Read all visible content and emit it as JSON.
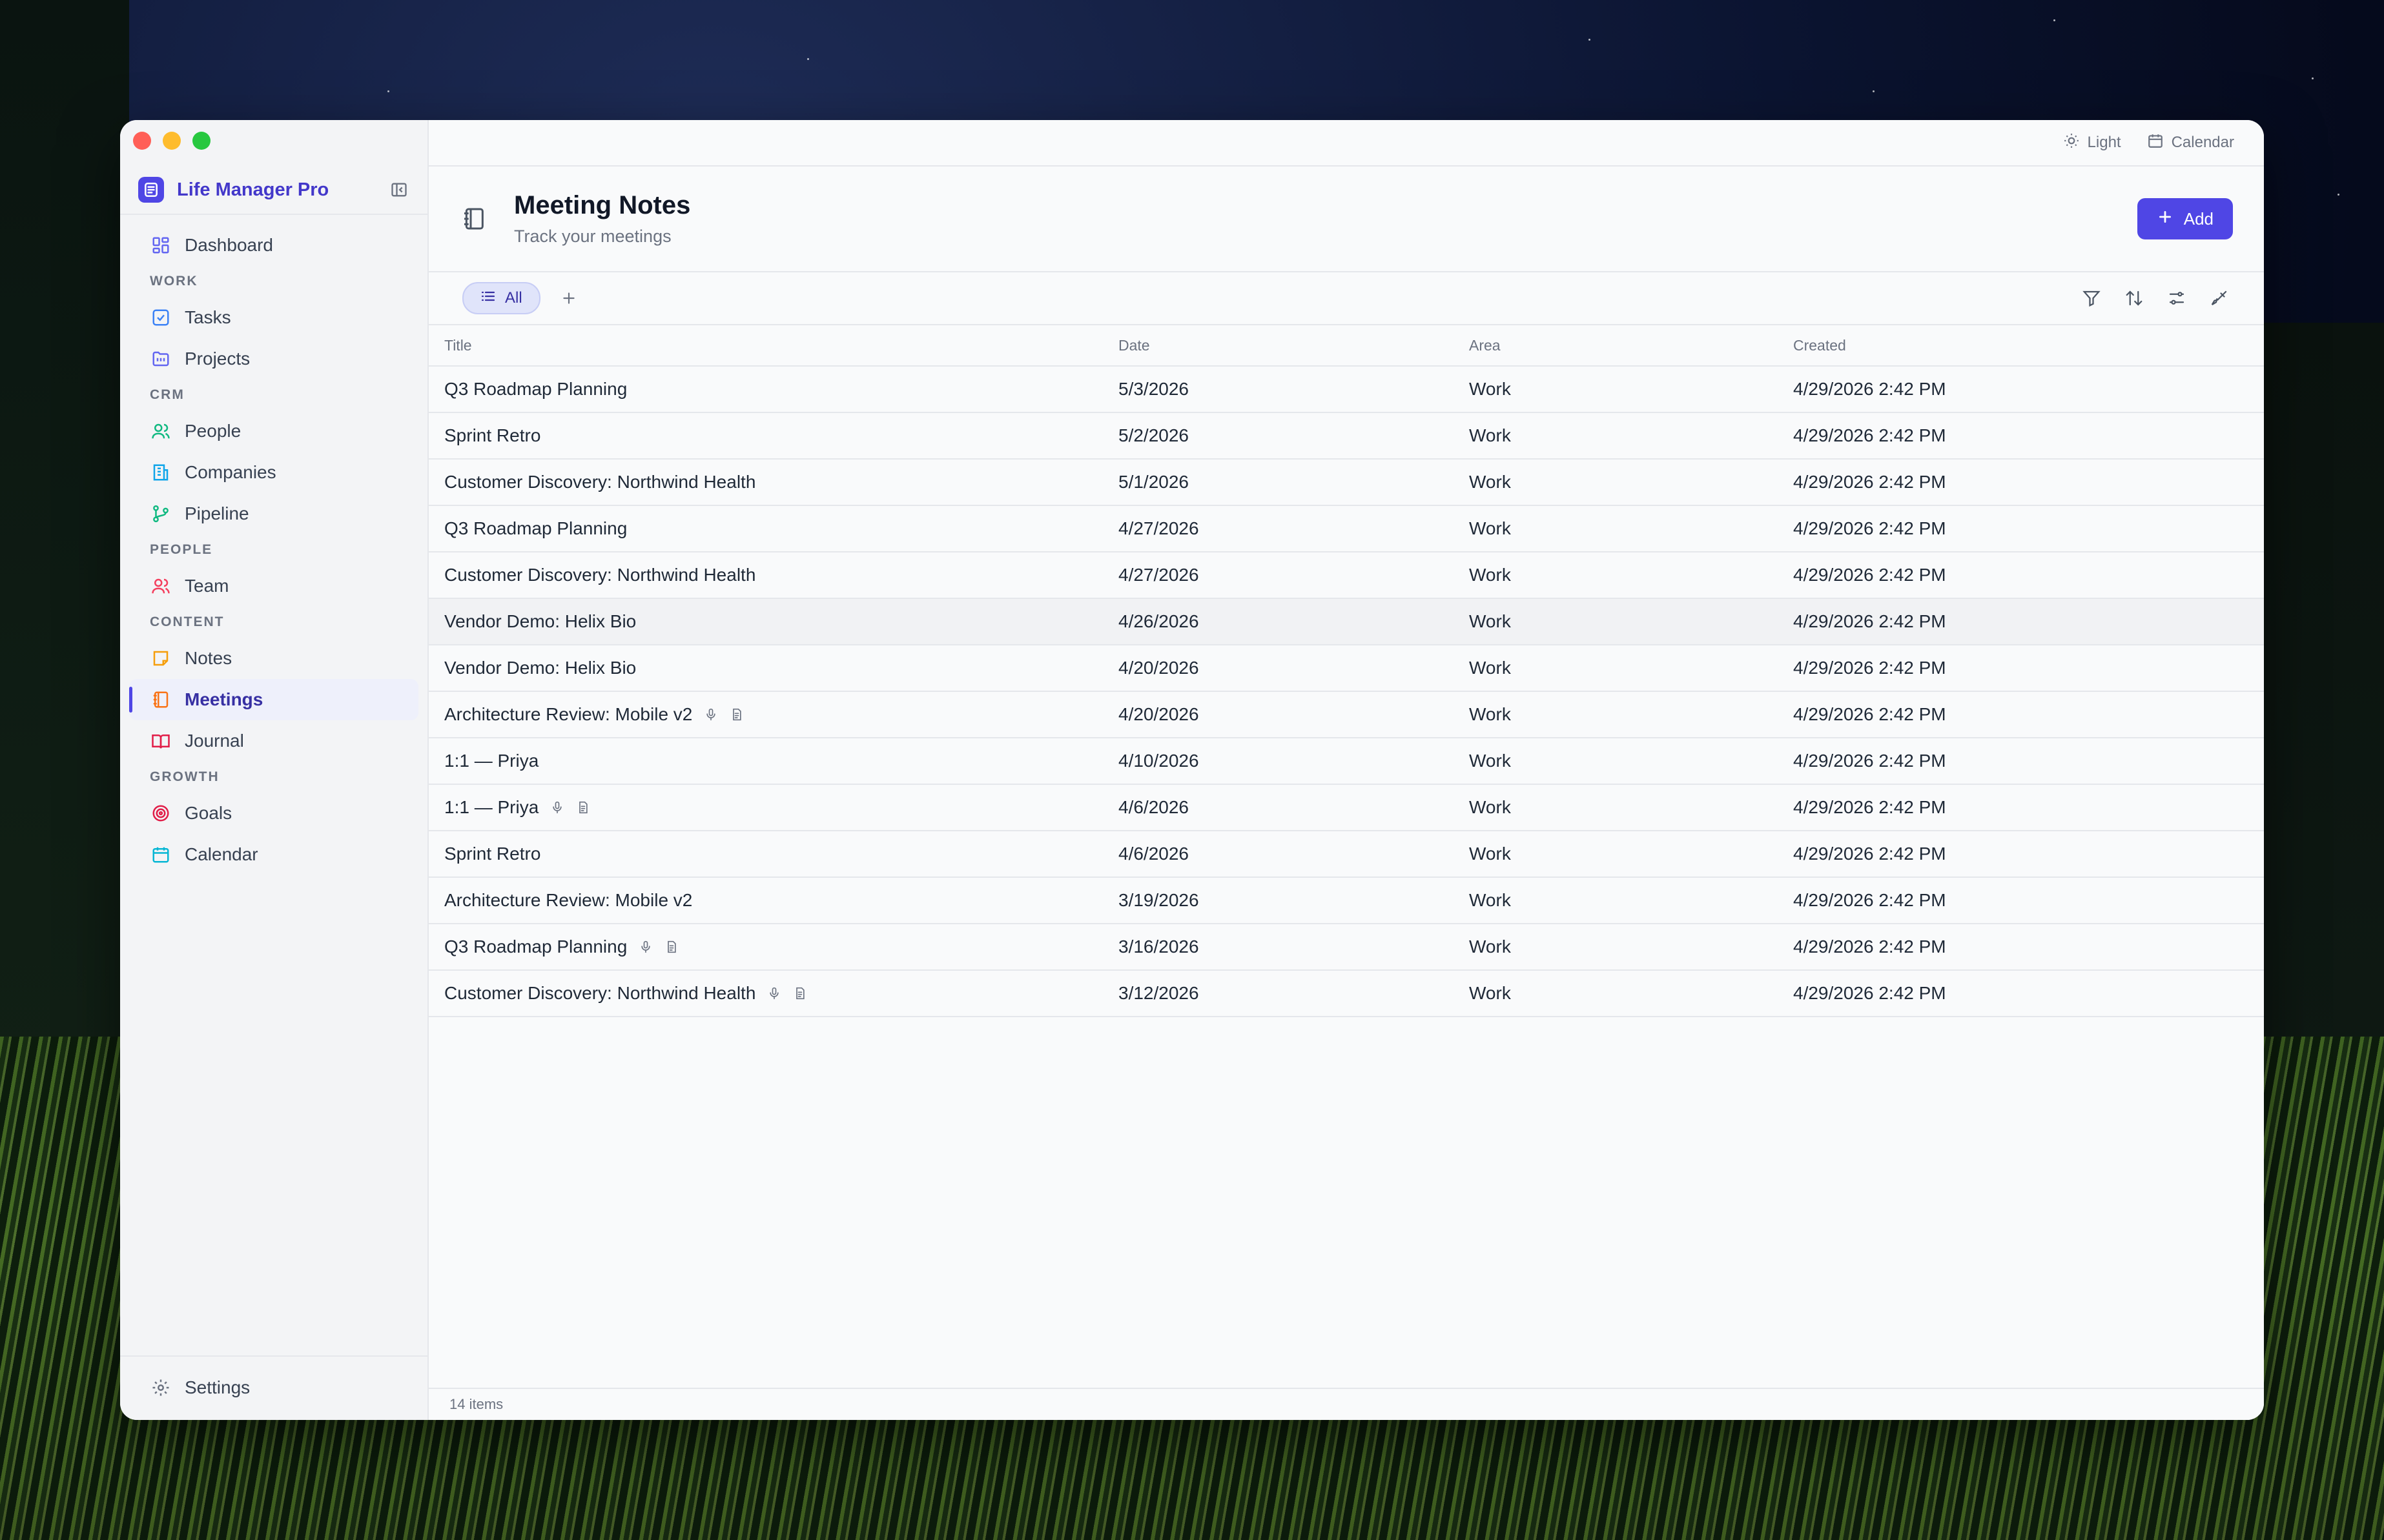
{
  "app": {
    "name": "Life Manager Pro"
  },
  "topbar": {
    "theme_label": "Light",
    "calendar_label": "Calendar"
  },
  "sidebar": {
    "dashboard": "Dashboard",
    "sections": [
      {
        "title": "WORK",
        "items": [
          "Tasks",
          "Projects"
        ]
      },
      {
        "title": "CRM",
        "items": [
          "People",
          "Companies",
          "Pipeline"
        ]
      },
      {
        "title": "PEOPLE",
        "items": [
          "Team"
        ]
      },
      {
        "title": "CONTENT",
        "items": [
          "Notes",
          "Meetings",
          "Journal"
        ]
      },
      {
        "title": "GROWTH",
        "items": [
          "Goals",
          "Calendar"
        ]
      }
    ],
    "settings": "Settings"
  },
  "header": {
    "title": "Meeting Notes",
    "subtitle": "Track your meetings",
    "add_label": "Add"
  },
  "views": {
    "active": "All"
  },
  "table": {
    "columns": [
      "Title",
      "Date",
      "Area",
      "Created"
    ],
    "rows": [
      {
        "title": "Q3 Roadmap Planning",
        "date": "5/3/2026",
        "area": "Work",
        "created": "4/29/2026 2:42 PM",
        "attachments": false
      },
      {
        "title": "Sprint Retro",
        "date": "5/2/2026",
        "area": "Work",
        "created": "4/29/2026 2:42 PM",
        "attachments": false
      },
      {
        "title": "Customer Discovery: Northwind Health",
        "date": "5/1/2026",
        "area": "Work",
        "created": "4/29/2026 2:42 PM",
        "attachments": false
      },
      {
        "title": "Q3 Roadmap Planning",
        "date": "4/27/2026",
        "area": "Work",
        "created": "4/29/2026 2:42 PM",
        "attachments": false
      },
      {
        "title": "Customer Discovery: Northwind Health",
        "date": "4/27/2026",
        "area": "Work",
        "created": "4/29/2026 2:42 PM",
        "attachments": false
      },
      {
        "title": "Vendor Demo: Helix Bio",
        "date": "4/26/2026",
        "area": "Work",
        "created": "4/29/2026 2:42 PM",
        "attachments": false
      },
      {
        "title": "Vendor Demo: Helix Bio",
        "date": "4/20/2026",
        "area": "Work",
        "created": "4/29/2026 2:42 PM",
        "attachments": false
      },
      {
        "title": "Architecture Review: Mobile v2",
        "date": "4/20/2026",
        "area": "Work",
        "created": "4/29/2026 2:42 PM",
        "attachments": true
      },
      {
        "title": "1:1 — Priya",
        "date": "4/10/2026",
        "area": "Work",
        "created": "4/29/2026 2:42 PM",
        "attachments": false
      },
      {
        "title": "1:1 — Priya",
        "date": "4/6/2026",
        "area": "Work",
        "created": "4/29/2026 2:42 PM",
        "attachments": true
      },
      {
        "title": "Sprint Retro",
        "date": "4/6/2026",
        "area": "Work",
        "created": "4/29/2026 2:42 PM",
        "attachments": false
      },
      {
        "title": "Architecture Review: Mobile v2",
        "date": "3/19/2026",
        "area": "Work",
        "created": "4/29/2026 2:42 PM",
        "attachments": false
      },
      {
        "title": "Q3 Roadmap Planning",
        "date": "3/16/2026",
        "area": "Work",
        "created": "4/29/2026 2:42 PM",
        "attachments": true
      },
      {
        "title": "Customer Discovery: Northwind Health",
        "date": "3/12/2026",
        "area": "Work",
        "created": "4/29/2026 2:42 PM",
        "attachments": true
      }
    ]
  },
  "footer": {
    "count": "14 items"
  },
  "colors": {
    "accent": "#4f46e5",
    "accent_text": "#4338ca"
  }
}
